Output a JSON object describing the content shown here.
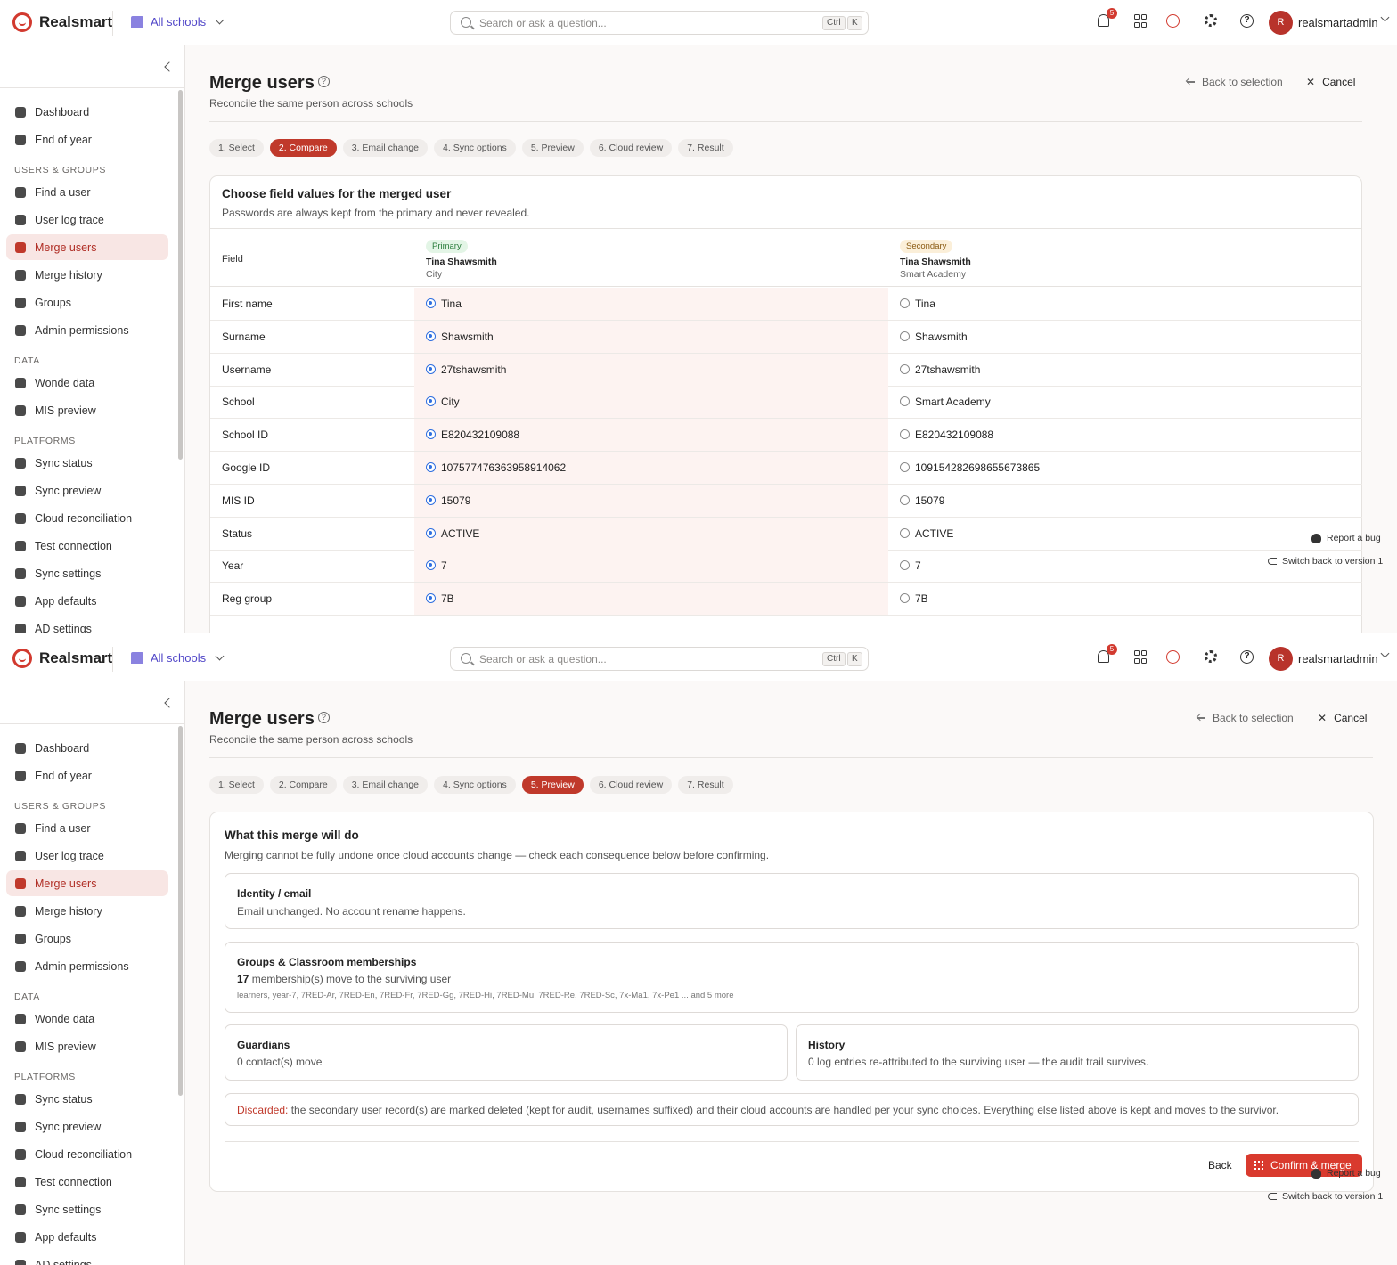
{
  "app": {
    "logo_text": "Realsmart",
    "school_selector": "All schools",
    "search_placeholder": "Search or ask a question...",
    "kbd_ctrl": "Ctrl",
    "kbd_k": "K",
    "notification_count": "5",
    "avatar_initial": "R",
    "user_name": "realsmartadmin",
    "colors": {
      "brand": "#d23a2f",
      "active_bg": "#f8e6e4",
      "selected_radio": "#2f6fe0"
    }
  },
  "sidebar": {
    "items_top": [
      {
        "label": "Dashboard",
        "icon": "dashboard-icon"
      },
      {
        "label": "End of year",
        "icon": "calendar-icon"
      }
    ],
    "section_users": "USERS & GROUPS",
    "items_users": [
      {
        "label": "Find a user",
        "icon": "user-search-icon"
      },
      {
        "label": "User log trace",
        "icon": "trace-icon"
      },
      {
        "label": "Merge users",
        "icon": "merge-icon"
      },
      {
        "label": "Merge history",
        "icon": "history-icon"
      },
      {
        "label": "Groups",
        "icon": "layers-icon"
      },
      {
        "label": "Admin permissions",
        "icon": "user-lock-icon"
      }
    ],
    "section_data": "DATA",
    "items_data": [
      {
        "label": "Wonde data",
        "icon": "cloud-download-icon"
      },
      {
        "label": "MIS preview",
        "icon": "eye-icon"
      }
    ],
    "section_platforms": "PLATFORMS",
    "items_platforms": [
      {
        "label": "Sync status",
        "icon": "refresh-icon"
      },
      {
        "label": "Sync preview",
        "icon": "eye-icon"
      },
      {
        "label": "Cloud reconciliation",
        "icon": "cloud-check-icon"
      },
      {
        "label": "Test connection",
        "icon": "stethoscope-icon"
      },
      {
        "label": "Sync settings",
        "icon": "gears-icon"
      },
      {
        "label": "App defaults",
        "icon": "rocket-icon"
      },
      {
        "label": "AD settings",
        "icon": "grid-icon"
      }
    ]
  },
  "header": {
    "title": "Merge users",
    "subtitle": "Reconcile the same person across schools",
    "back_label": "Back to selection",
    "cancel_label": "Cancel"
  },
  "steps": [
    "1. Select",
    "2. Compare",
    "3. Email change",
    "4. Sync options",
    "5. Preview",
    "6. Cloud review",
    "7. Result"
  ],
  "compare": {
    "title": "Choose field values for the merged user",
    "subtitle": "Passwords are always kept from the primary and never revealed.",
    "field_header": "Field",
    "primary": {
      "tag": "Primary",
      "name": "Tina Shawsmith",
      "school": "City"
    },
    "secondary": {
      "tag": "Secondary",
      "name": "Tina Shawsmith",
      "school": "Smart Academy"
    },
    "rows": [
      {
        "field": "First name",
        "primary": "Tina",
        "secondary": "Tina"
      },
      {
        "field": "Surname",
        "primary": "Shawsmith",
        "secondary": "Shawsmith"
      },
      {
        "field": "Username",
        "primary": "27tshawsmith",
        "secondary": "27tshawsmith"
      },
      {
        "field": "School",
        "primary": "City",
        "secondary": "Smart Academy"
      },
      {
        "field": "School ID",
        "primary": "E820432109088",
        "secondary": "E820432109088"
      },
      {
        "field": "Google ID",
        "primary": "107577476363958914062",
        "secondary": "109154282698655673865"
      },
      {
        "field": "MIS ID",
        "primary": "15079",
        "secondary": "15079"
      },
      {
        "field": "Status",
        "primary": "ACTIVE",
        "secondary": "ACTIVE"
      },
      {
        "field": "Year",
        "primary": "7",
        "secondary": "7"
      },
      {
        "field": "Reg group",
        "primary": "7B",
        "secondary": "7B"
      }
    ]
  },
  "floating": {
    "report_bug": "Report a bug",
    "switch_version": "Switch back to version 1"
  },
  "preview": {
    "title": "What this merge will do",
    "subtitle": "Merging cannot be fully undone once cloud accounts change — check each consequence below before confirming.",
    "identity": {
      "title": "Identity / email",
      "text": "Email unchanged. No account rename happens."
    },
    "groups": {
      "title": "Groups & Classroom memberships",
      "count": "17",
      "text": "membership(s) move to the surviving user",
      "list": "learners, year-7, 7RED-Ar, 7RED-En, 7RED-Fr, 7RED-Gg, 7RED-Hi, 7RED-Mu, 7RED-Re, 7RED-Sc, 7x-Ma1, 7x-Pe1 ... and 5 more"
    },
    "guardians": {
      "title": "Guardians",
      "text": "0 contact(s) move"
    },
    "history": {
      "title": "History",
      "text": "0 log entries re-attributed to the surviving user — the audit trail survives."
    },
    "discarded_label": "Discarded:",
    "discarded_text": "the secondary user record(s) are marked deleted (kept for audit, usernames suffixed) and their cloud accounts are handled per your sync choices. Everything else listed above is kept and moves to the survivor.",
    "back_button": "Back",
    "confirm_button": "Confirm & merge"
  }
}
